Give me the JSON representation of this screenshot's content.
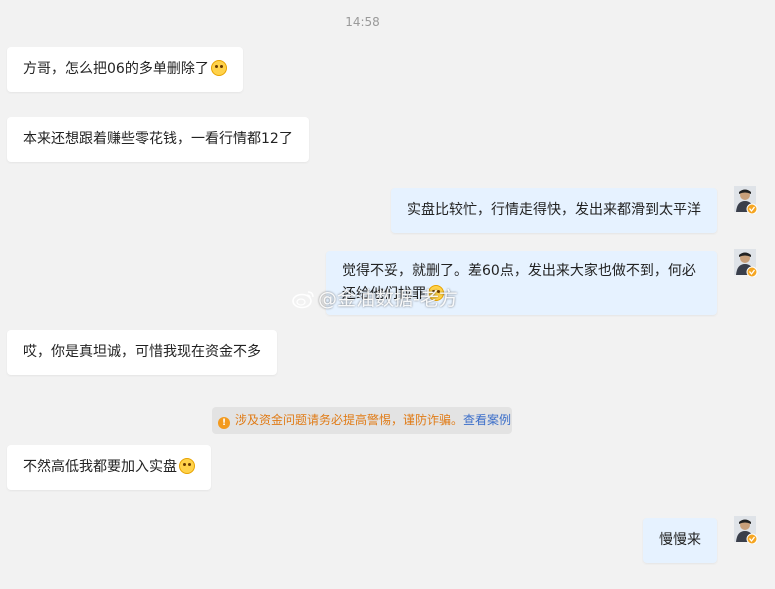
{
  "timestamp": "14:58",
  "messages": [
    {
      "side": "left",
      "text": "方哥，怎么把06的多单删除了",
      "emoji": "crying-laughing-emoji"
    },
    {
      "side": "left",
      "text": "本来还想跟着赚些零花钱，一看行情都12了"
    },
    {
      "side": "right",
      "text": "实盘比较忙，行情走得快，发出来都滑到太平洋"
    },
    {
      "side": "right",
      "text_line1": "觉得不妥，就删了。差60点，发出来大家也做不到，何必",
      "text_line2": "还给他们找罪",
      "emoji": "grinning-emoji"
    },
    {
      "side": "left",
      "text": "哎，你是真坦诚，可惜我现在资金不多"
    },
    {
      "side": "left",
      "text": "不然高低我都要加入实盘",
      "emoji": "laughing-emoji"
    },
    {
      "side": "right",
      "text": "慢慢来"
    }
  ],
  "warning": {
    "icon": "warning-icon",
    "text": "涉及资金问题请务必提高警惕，谨防诈骗。",
    "link": "查看案例"
  },
  "watermark": "@金油数据-老方",
  "colors": {
    "bubble_left": "#ffffff",
    "bubble_right": "#e6f2ff",
    "background": "#f2f2f2",
    "warning_text": "#e07b16",
    "link": "#3b6ec9",
    "verified_badge": "#f5a623"
  }
}
